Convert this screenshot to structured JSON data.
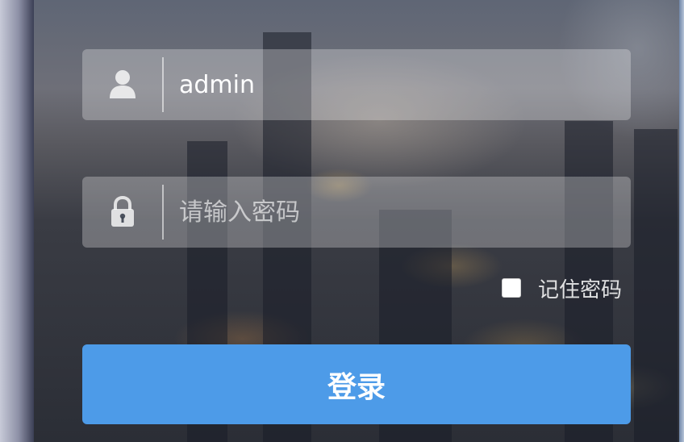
{
  "login_form": {
    "username": {
      "icon": "user-icon",
      "value": "admin"
    },
    "password": {
      "icon": "lock-icon",
      "placeholder": "请输入密码",
      "value": ""
    },
    "remember_me": {
      "label": "记住密码",
      "checked": false
    },
    "submit_label": "登录"
  },
  "colors": {
    "accent": "#4d9be8"
  }
}
